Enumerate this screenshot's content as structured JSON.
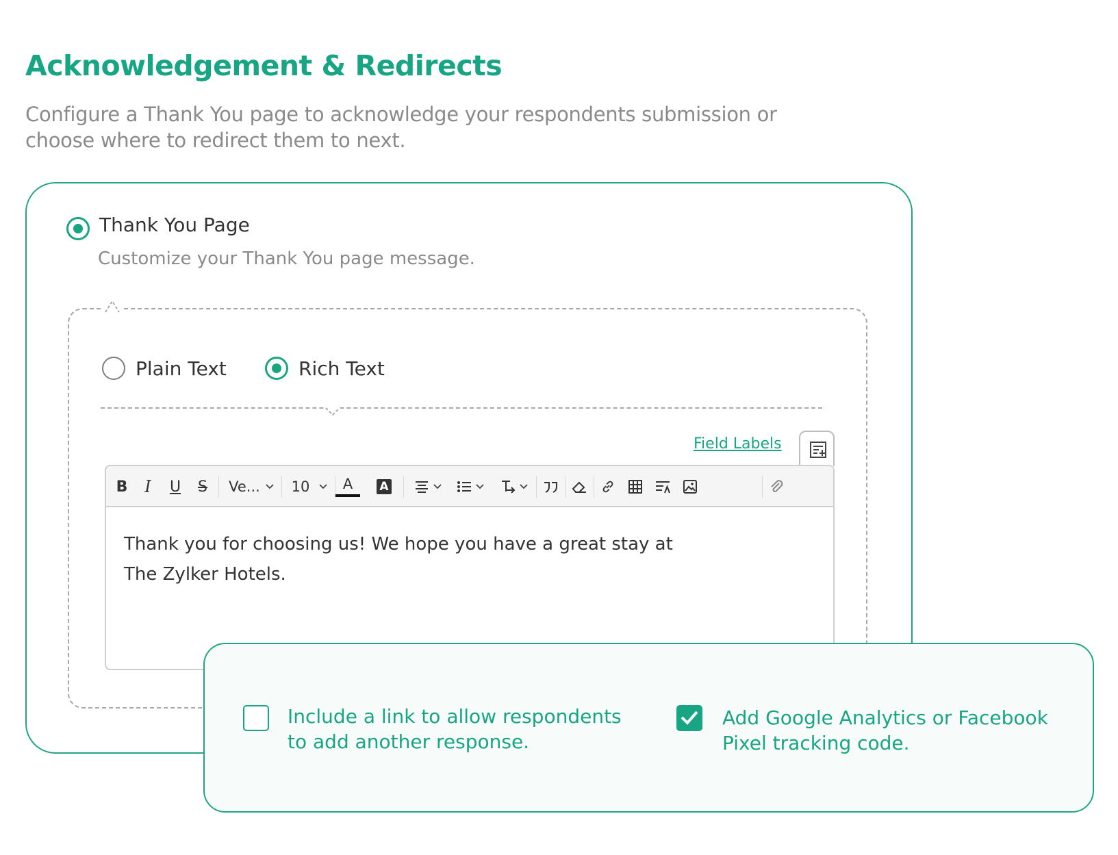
{
  "header": {
    "title": "Acknowledgement & Redirects",
    "subtitle": "Configure a Thank You page to acknowledge your respondents submission or choose where to redirect them to next."
  },
  "thank_you": {
    "label": "Thank You Page",
    "description": "Customize your Thank You page message.",
    "selected": true
  },
  "message_format": {
    "plain_label": "Plain Text",
    "rich_label": "Rich Text",
    "selected": "Rich Text"
  },
  "editor": {
    "field_labels_link": "Field Labels",
    "toolbar": {
      "bold": "B",
      "italic": "I",
      "underline": "U",
      "strike": "S",
      "font": "Ve...",
      "size": "10",
      "text_color": "A",
      "highlight": "A",
      "icons": [
        "bold-icon",
        "italic-icon",
        "underline-icon",
        "strikethrough-icon",
        "font-family-dropdown",
        "font-size-dropdown",
        "text-color-icon",
        "highlight-icon",
        "align-icon",
        "list-icon",
        "text-direction-icon",
        "quote-icon",
        "eraser-icon",
        "link-icon",
        "table-icon",
        "line-spacing-icon",
        "image-icon",
        "attachment-icon"
      ]
    },
    "content": "Thank you for choosing us! We hope you have a great stay at The Zylker Hotels."
  },
  "options": {
    "add_another": {
      "label": "Include a link to allow respondents to add another response.",
      "checked": false
    },
    "tracking": {
      "label": "Add Google Analytics or Facebook Pixel tracking code.",
      "checked": true
    }
  },
  "colors": {
    "accent": "#18a584",
    "border": "#20a685",
    "muted_text": "#8a8a8a"
  }
}
